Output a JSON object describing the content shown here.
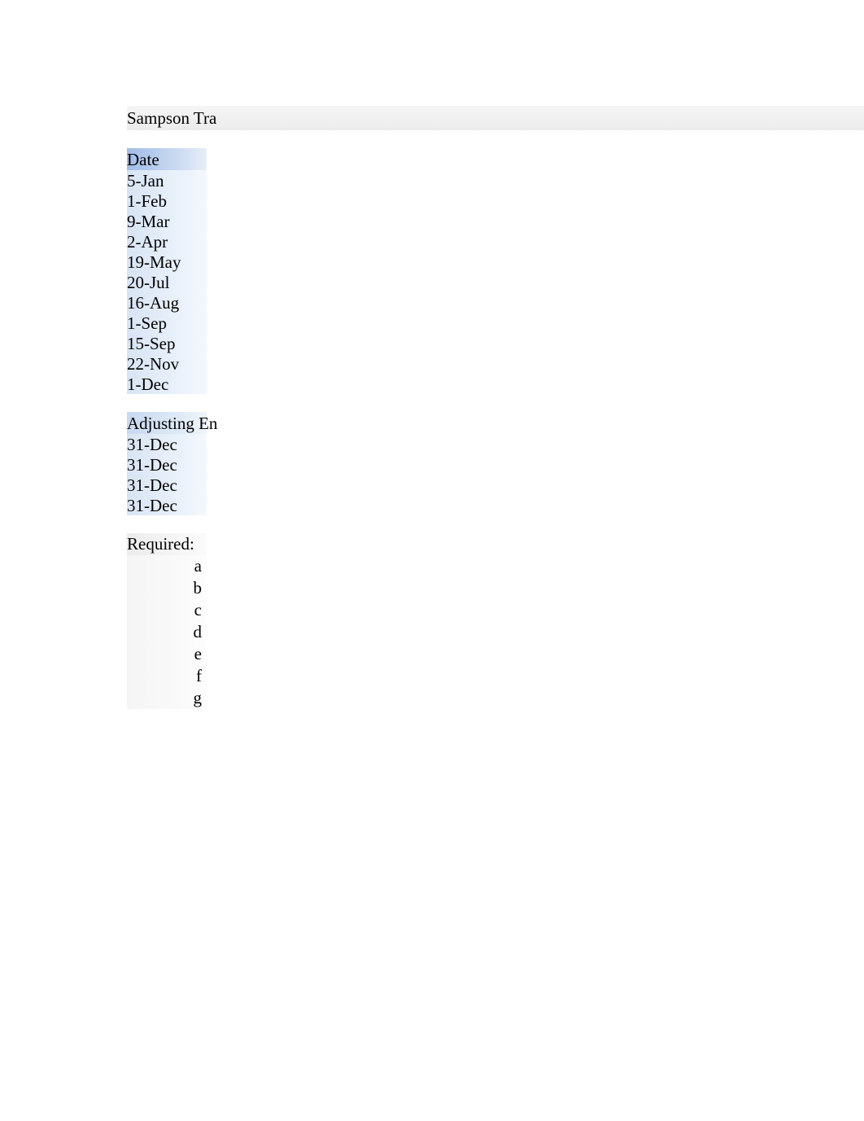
{
  "title": "Sampson Tra",
  "dateHeader": "Date",
  "dates": [
    "5-Jan",
    "1-Feb",
    "9-Mar",
    "2-Apr",
    "19-May",
    "20-Jul",
    "16-Aug",
    "1-Sep",
    "15-Sep",
    "22-Nov",
    "1-Dec"
  ],
  "adjustingHeader": "Adjusting En",
  "adjustingDates": [
    "31-Dec",
    "31-Dec",
    "31-Dec",
    "31-Dec"
  ],
  "requiredLabel": "Required:",
  "requiredItems": [
    "a",
    "b",
    "c",
    "d",
    "e",
    "f",
    "g"
  ]
}
